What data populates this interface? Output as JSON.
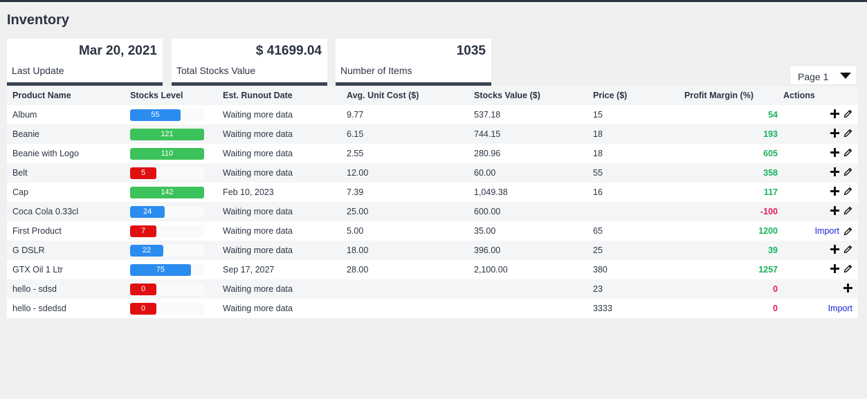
{
  "page_title": "Inventory",
  "cards": [
    {
      "value": "Mar 20, 2021",
      "label": "Last Update"
    },
    {
      "value": "$ 41699.04",
      "label": "Total Stocks Value"
    },
    {
      "value": "1035",
      "label": "Number of Items"
    }
  ],
  "pager": {
    "label": "Page 1"
  },
  "table": {
    "headers": [
      "Product Name",
      "Stocks Level",
      "Est. Runout Date",
      "Avg. Unit Cost ($)",
      "Stocks Value ($)",
      "Price ($)",
      "Profit Margin (%)",
      "Actions"
    ],
    "rows": [
      {
        "name": "Album",
        "stock": "55",
        "stock_fill": 0.68,
        "stock_color": "#2b8cf0",
        "runout": "Waiting more data",
        "avg_cost": "9.77",
        "stock_value": "537.18",
        "price": "15",
        "margin": "54",
        "margin_color": "#17b35a",
        "actions": "plus-edit"
      },
      {
        "name": "Beanie",
        "stock": "121",
        "stock_fill": 1.0,
        "stock_color": "#3cc25a",
        "runout": "Waiting more data",
        "avg_cost": "6.15",
        "stock_value": "744.15",
        "price": "18",
        "margin": "193",
        "margin_color": "#17b35a",
        "actions": "plus-edit"
      },
      {
        "name": "Beanie with Logo",
        "stock": "110",
        "stock_fill": 1.0,
        "stock_color": "#3cc25a",
        "runout": "Waiting more data",
        "avg_cost": "2.55",
        "stock_value": "280.96",
        "price": "18",
        "margin": "605",
        "margin_color": "#17b35a",
        "actions": "plus-edit"
      },
      {
        "name": "Belt",
        "stock": "5",
        "stock_fill": 0.35,
        "stock_color": "#e01010",
        "runout": "Waiting more data",
        "avg_cost": "12.00",
        "stock_value": "60.00",
        "price": "55",
        "margin": "358",
        "margin_color": "#17b35a",
        "actions": "plus-edit"
      },
      {
        "name": "Cap",
        "stock": "142",
        "stock_fill": 1.0,
        "stock_color": "#3cc25a",
        "runout": "Feb 10, 2023",
        "avg_cost": "7.39",
        "stock_value": "1,049.38",
        "price": "16",
        "margin": "117",
        "margin_color": "#17b35a",
        "actions": "plus-edit"
      },
      {
        "name": "Coca Cola 0.33cl",
        "stock": "24",
        "stock_fill": 0.47,
        "stock_color": "#2b8cf0",
        "runout": "Waiting more data",
        "avg_cost": "25.00",
        "stock_value": "600.00",
        "price": "",
        "margin": "-100",
        "margin_color": "#e8175d",
        "actions": "plus-edit"
      },
      {
        "name": "First Product",
        "stock": "7",
        "stock_fill": 0.35,
        "stock_color": "#e01010",
        "runout": "Waiting more data",
        "avg_cost": "5.00",
        "stock_value": "35.00",
        "price": "65",
        "margin": "1200",
        "margin_color": "#17b35a",
        "actions": "import-edit"
      },
      {
        "name": "G DSLR",
        "stock": "22",
        "stock_fill": 0.45,
        "stock_color": "#2b8cf0",
        "runout": "Waiting more data",
        "avg_cost": "18.00",
        "stock_value": "396.00",
        "price": "25",
        "margin": "39",
        "margin_color": "#17b35a",
        "actions": "plus-edit"
      },
      {
        "name": "GTX Oil 1 Ltr",
        "stock": "75",
        "stock_fill": 0.82,
        "stock_color": "#2b8cf0",
        "runout": "Sep 17, 2027",
        "avg_cost": "28.00",
        "stock_value": "2,100.00",
        "price": "380",
        "margin": "1257",
        "margin_color": "#17b35a",
        "actions": "plus-edit"
      },
      {
        "name": "hello - sdsd",
        "stock": "0",
        "stock_fill": 0.35,
        "stock_color": "#e01010",
        "runout": "Waiting more data",
        "avg_cost": "",
        "stock_value": "",
        "price": "23",
        "margin": "0",
        "margin_color": "#e8175d",
        "actions": "plus"
      },
      {
        "name": "hello - sdedsd",
        "stock": "0",
        "stock_fill": 0.35,
        "stock_color": "#e01010",
        "runout": "Waiting more data",
        "avg_cost": "",
        "stock_value": "",
        "price": "3333",
        "margin": "0",
        "margin_color": "#e8175d",
        "actions": "import"
      }
    ],
    "import_label": "Import"
  },
  "icons": {
    "add": "plus-icon",
    "edit": "pencil-icon",
    "dropdown": "caret-down-icon"
  }
}
